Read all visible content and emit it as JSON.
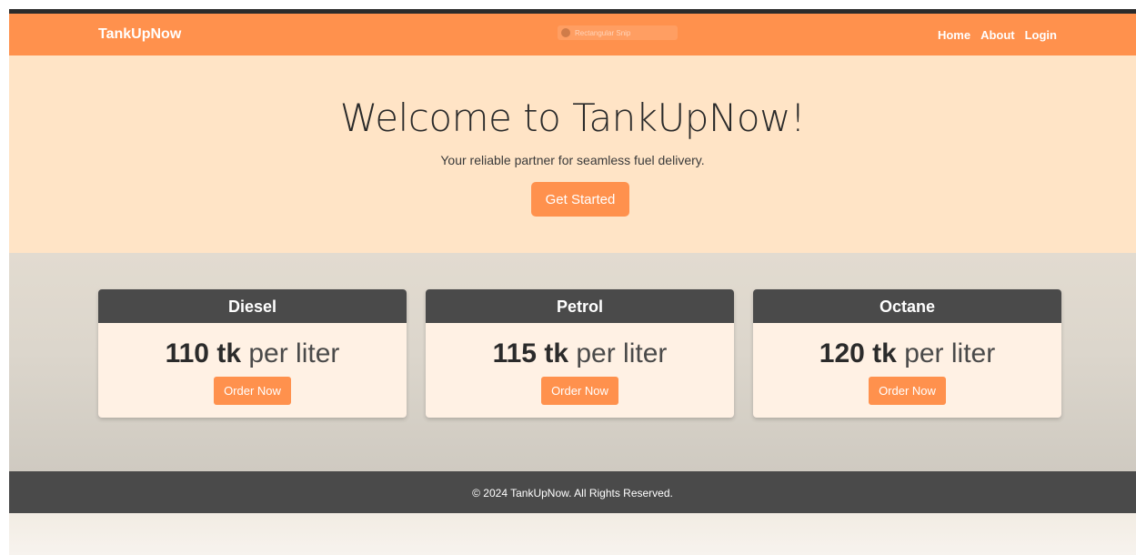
{
  "navbar": {
    "brand": "TankUpNow",
    "links": [
      "Home",
      "About",
      "Login"
    ],
    "overlay_label": "Rectangular Snip"
  },
  "hero": {
    "title": "Welcome to TankUpNow!",
    "subtitle": "Your reliable partner for seamless fuel delivery.",
    "cta_label": "Get Started"
  },
  "cards": [
    {
      "title": "Diesel",
      "price": "110 tk",
      "unit": "per liter",
      "button": "Order Now"
    },
    {
      "title": "Petrol",
      "price": "115 tk",
      "unit": "per liter",
      "button": "Order Now"
    },
    {
      "title": "Octane",
      "price": "120 tk",
      "unit": "per liter",
      "button": "Order Now"
    }
  ],
  "footer": {
    "text": "© 2024 TankUpNow. All Rights Reserved."
  },
  "colors": {
    "accent": "#ff914d",
    "hero_bg": "#ffe4c6",
    "dark": "#4a4a4a",
    "card_bg": "#fff1e4"
  }
}
